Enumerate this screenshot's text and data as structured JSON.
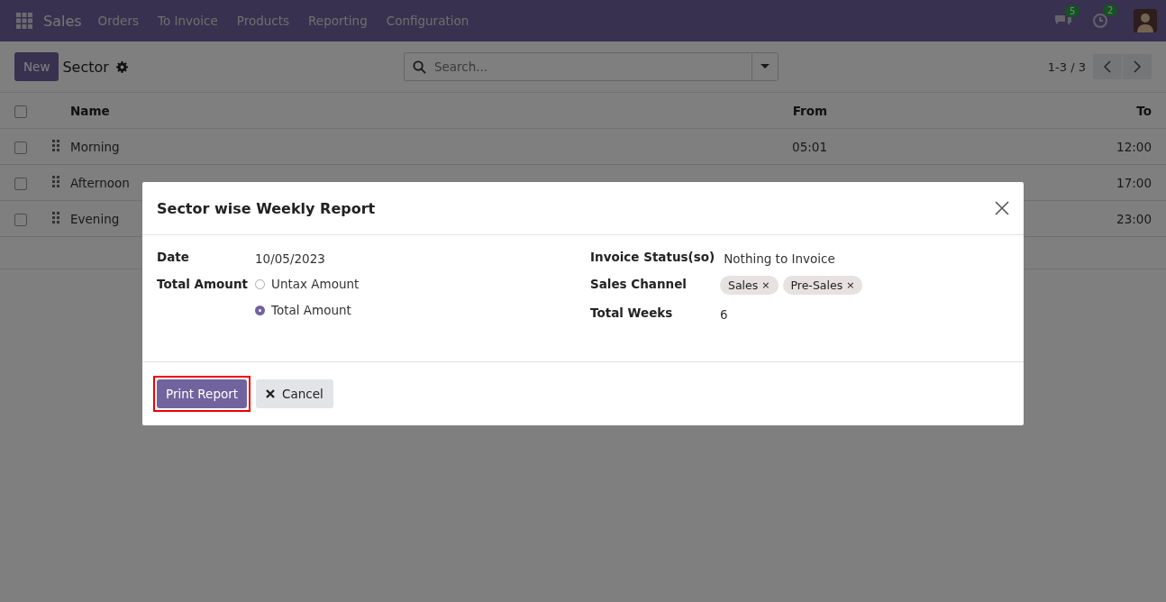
{
  "navbar": {
    "app": "Sales",
    "menu": [
      "Orders",
      "To Invoice",
      "Products",
      "Reporting",
      "Configuration"
    ],
    "messages_count": "5",
    "activities_count": "2"
  },
  "control_panel": {
    "new_button": "New",
    "title": "Sector",
    "search": {
      "placeholder": "Search..."
    },
    "pager": "1-3 / 3"
  },
  "table": {
    "all_selected": false,
    "columns": [
      "Name",
      "From",
      "To"
    ],
    "rows": [
      {
        "name": "Morning",
        "from": "05:01",
        "to": "12:00",
        "selected": false
      },
      {
        "name": "Afternoon",
        "to": "17:00",
        "selected": false
      },
      {
        "name": "Evening",
        "to": "23:00",
        "selected": false
      }
    ]
  },
  "dialog": {
    "title": "Sector wise Weekly Report",
    "left_fields": [
      {
        "kind": "text",
        "label": "Date",
        "value": "10/05/2023"
      },
      {
        "kind": "radio",
        "label": "Total Amount",
        "options": [
          {
            "label": "Untax Amount",
            "selected": false
          },
          {
            "label": "Total Amount",
            "selected": true
          }
        ]
      }
    ],
    "right_fields": [
      {
        "kind": "text",
        "label": "Invoice Status(so)",
        "value": "Nothing to Invoice"
      },
      {
        "kind": "tags",
        "label": "Sales Channel",
        "tags": [
          {
            "label": "Sales",
            "remove": "×"
          },
          {
            "label": "Pre-Sales",
            "remove": "×"
          }
        ]
      },
      {
        "kind": "text",
        "label": "Total Weeks",
        "value": "6"
      }
    ],
    "buttons": [
      {
        "kind": "primary",
        "label": "Print Report",
        "highlighted": true
      },
      {
        "kind": "secondary",
        "label": "Cancel"
      }
    ]
  }
}
